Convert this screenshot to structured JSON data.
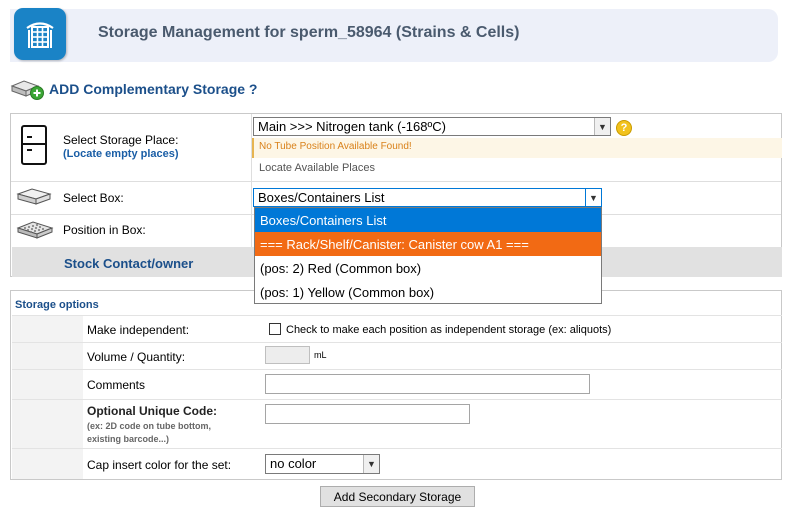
{
  "header": {
    "title": "Storage Management for sperm_58964 (Strains & Cells)",
    "icon": "storage-rack-icon",
    "icon_color": "#1a83c6"
  },
  "section": {
    "title": "ADD Complementary Storage ?",
    "icon": "add-storage-icon"
  },
  "storage": {
    "place_label": "Select Storage Place:",
    "locate_empty_label": "(Locate empty places)",
    "place_value": "Main >>> Nitrogen tank (-168ºC)",
    "warning": "No Tube Position Available Found!",
    "locate_available": "Locate Available Places",
    "box_label": "Select Box:",
    "box_value": "Boxes/Containers List",
    "position_label": "Position in Box:",
    "stock_contact_title": "Stock Contact/owner"
  },
  "dropdown": {
    "options": [
      "Boxes/Containers List",
      "=== Rack/Shelf/Canister: Canister cow A1 ===",
      "(pos: 2) Red (Common box)",
      "(pos: 1) Yellow (Common box)"
    ],
    "selected_color": "#0078d7",
    "highlight_color": "#f26a14"
  },
  "options": {
    "title": "Storage options",
    "make_independent_label": "Make independent:",
    "make_independent_text": "Check to make each position as independent storage (ex: aliquots)",
    "volume_label": "Volume / Quantity:",
    "volume_unit": "mL",
    "comments_label": "Comments",
    "unique_code_label": "Optional Unique Code:",
    "unique_code_hint_1": "(ex: 2D code on tube bottom,",
    "unique_code_hint_2": "existing barcode...)",
    "cap_color_label": "Cap insert color for the set:",
    "cap_color_value": "no color"
  },
  "actions": {
    "add_secondary": "Add Secondary Storage"
  }
}
